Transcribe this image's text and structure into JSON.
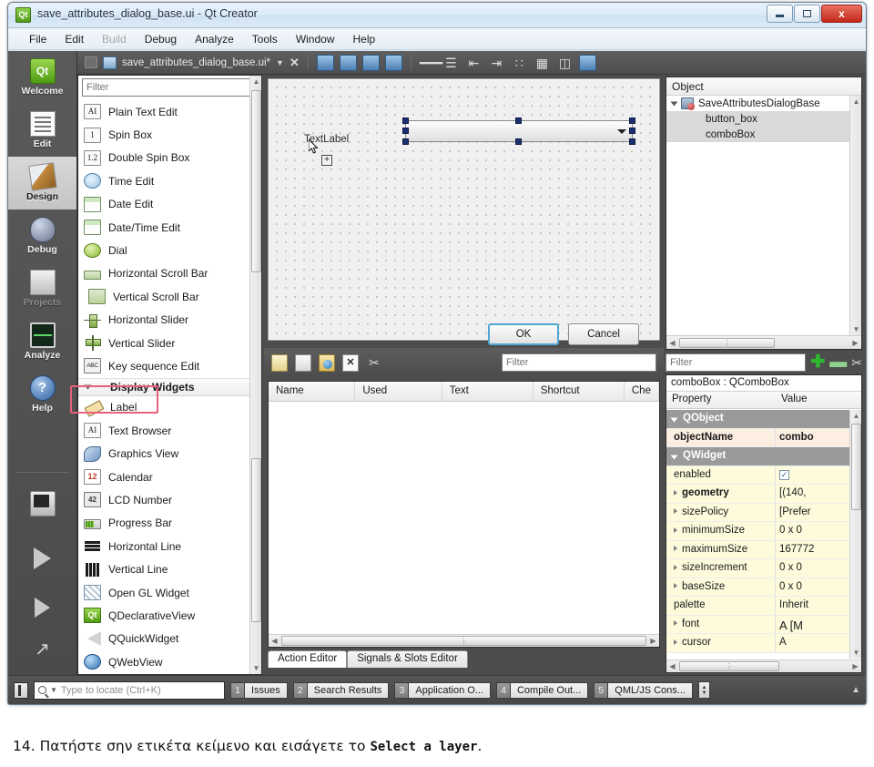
{
  "window": {
    "title": "save_attributes_dialog_base.ui - Qt Creator",
    "app_icon": "qt-logo-icon",
    "minimize_label": "",
    "maximize_label": "",
    "close_label": "x"
  },
  "menubar": {
    "items": [
      {
        "label": "File",
        "disabled": false
      },
      {
        "label": "Edit",
        "disabled": false
      },
      {
        "label": "Build",
        "disabled": true
      },
      {
        "label": "Debug",
        "disabled": false
      },
      {
        "label": "Analyze",
        "disabled": false
      },
      {
        "label": "Tools",
        "disabled": false
      },
      {
        "label": "Window",
        "disabled": false
      },
      {
        "label": "Help",
        "disabled": false
      }
    ]
  },
  "modebar": {
    "items": [
      {
        "label": "Welcome",
        "icon": "qt-logo-icon",
        "active": false,
        "dim": false
      },
      {
        "label": "Edit",
        "icon": "document-lines-icon",
        "active": false,
        "dim": false
      },
      {
        "label": "Design",
        "icon": "paintbrush-icon",
        "active": true,
        "dim": false
      },
      {
        "label": "Debug",
        "icon": "bug-icon",
        "active": false,
        "dim": false
      },
      {
        "label": "Projects",
        "icon": "folder-icon",
        "active": false,
        "dim": true
      },
      {
        "label": "Analyze",
        "icon": "oscilloscope-icon",
        "active": false,
        "dim": false
      },
      {
        "label": "Help",
        "icon": "question-mark-icon",
        "active": false,
        "dim": false
      }
    ]
  },
  "filebar": {
    "lock_icon": "unlocked-padlock-icon",
    "file_icon": "ui-file-icon",
    "filename": "save_attributes_dialog_base.ui*",
    "dropdown_icon": "chevron-down-icon",
    "close_icon": "close-x-icon",
    "designer_tools": [
      {
        "name": "edit-widgets-icon"
      },
      {
        "name": "edit-signals-slots-icon"
      },
      {
        "name": "edit-buddies-icon"
      },
      {
        "name": "edit-tab-order-icon"
      },
      {
        "name": "layout-horizontally-icon"
      },
      {
        "name": "layout-vertically-icon"
      },
      {
        "name": "layout-splitter-horizontal-icon"
      },
      {
        "name": "layout-splitter-vertical-icon"
      },
      {
        "name": "layout-form-icon"
      },
      {
        "name": "layout-grid-icon"
      },
      {
        "name": "break-layout-icon"
      },
      {
        "name": "adjust-size-icon"
      }
    ]
  },
  "widgetbox": {
    "filter_placeholder": "Filter",
    "filter_value": "",
    "items": [
      {
        "label": "Plain Text Edit",
        "icon": "plain-text-edit-icon",
        "kind": "item",
        "glyph": "AI"
      },
      {
        "label": "Spin Box",
        "icon": "spin-box-icon",
        "kind": "item",
        "glyph": "1"
      },
      {
        "label": "Double Spin Box",
        "icon": "double-spin-box-icon",
        "kind": "item",
        "glyph": "1.2"
      },
      {
        "label": "Time Edit",
        "icon": "time-edit-icon",
        "kind": "item",
        "glyph": ""
      },
      {
        "label": "Date Edit",
        "icon": "date-edit-icon",
        "kind": "item",
        "glyph": ""
      },
      {
        "label": "Date/Time Edit",
        "icon": "date-time-edit-icon",
        "kind": "item",
        "glyph": ""
      },
      {
        "label": "Dial",
        "icon": "dial-icon",
        "kind": "item",
        "glyph": ""
      },
      {
        "label": "Horizontal Scroll Bar",
        "icon": "horizontal-scroll-bar-icon",
        "kind": "item",
        "glyph": ""
      },
      {
        "label": "Vertical Scroll Bar",
        "icon": "vertical-scroll-bar-icon",
        "kind": "item",
        "glyph": ""
      },
      {
        "label": "Horizontal Slider",
        "icon": "horizontal-slider-icon",
        "kind": "item",
        "glyph": ""
      },
      {
        "label": "Vertical Slider",
        "icon": "vertical-slider-icon",
        "kind": "item",
        "glyph": ""
      },
      {
        "label": "Key sequence Edit",
        "icon": "key-sequence-edit-icon",
        "kind": "item",
        "glyph": "ABC"
      },
      {
        "label": "Display Widgets",
        "icon": "category-collapse-icon",
        "kind": "category",
        "glyph": ""
      },
      {
        "label": "Label",
        "icon": "label-icon",
        "kind": "item",
        "glyph": ""
      },
      {
        "label": "Text Browser",
        "icon": "text-browser-icon",
        "kind": "item",
        "glyph": "AI"
      },
      {
        "label": "Graphics View",
        "icon": "graphics-view-icon",
        "kind": "item",
        "glyph": ""
      },
      {
        "label": "Calendar",
        "icon": "calendar-icon",
        "kind": "item",
        "glyph": "12"
      },
      {
        "label": "LCD Number",
        "icon": "lcd-number-icon",
        "kind": "item",
        "glyph": "42"
      },
      {
        "label": "Progress Bar",
        "icon": "progress-bar-icon",
        "kind": "item",
        "glyph": ""
      },
      {
        "label": "Horizontal Line",
        "icon": "horizontal-line-icon",
        "kind": "item",
        "glyph": ""
      },
      {
        "label": "Vertical Line",
        "icon": "vertical-line-icon",
        "kind": "item",
        "glyph": ""
      },
      {
        "label": "Open GL Widget",
        "icon": "open-gl-widget-icon",
        "kind": "item",
        "glyph": ""
      },
      {
        "label": "QDeclarativeView",
        "icon": "qt-logo-icon",
        "kind": "item",
        "glyph": "Qt"
      },
      {
        "label": "QQuickWidget",
        "icon": "qquick-widget-icon",
        "kind": "item",
        "glyph": ""
      },
      {
        "label": "QWebView",
        "icon": "qweb-view-icon",
        "kind": "item",
        "glyph": ""
      }
    ],
    "highlighted_item": "Label"
  },
  "form": {
    "label_text": "TextLabel",
    "combobox_selected": true,
    "ok_button": "OK",
    "cancel_button": "Cancel",
    "cursor_icon": "mouse-pointer-icon",
    "drop-badge": "+"
  },
  "action_editor": {
    "toolbar": [
      {
        "name": "new-action-icon"
      },
      {
        "name": "open-folder-icon"
      },
      {
        "name": "copy-action-icon"
      },
      {
        "name": "delete-action-icon"
      },
      {
        "name": "configure-wrench-icon"
      }
    ],
    "filter_placeholder": "Filter",
    "filter_value": "",
    "columns": [
      "Name",
      "Used",
      "Text",
      "Shortcut",
      "Che"
    ],
    "rows": [],
    "tabs": [
      {
        "label": "Action Editor",
        "active": true
      },
      {
        "label": "Signals & Slots Editor",
        "active": false
      }
    ]
  },
  "object_inspector": {
    "header": "Object",
    "nodes": [
      {
        "label": "SaveAttributesDialogBase",
        "depth": 0,
        "selected": false,
        "has_icon": true,
        "expanded": true
      },
      {
        "label": "button_box",
        "depth": 1,
        "selected": true,
        "has_icon": false,
        "expanded": false
      },
      {
        "label": "comboBox",
        "depth": 1,
        "selected": true,
        "has_icon": false,
        "expanded": false
      }
    ]
  },
  "property_editor": {
    "filter_placeholder": "Filter",
    "filter_value": "",
    "add_icon": "plus-icon",
    "remove_icon": "minus-icon",
    "configure_icon": "wrench-icon",
    "subject": "comboBox : QComboBox",
    "columns": [
      "Property",
      "Value"
    ],
    "rows": [
      {
        "name": "QObject",
        "value": "",
        "type": "group"
      },
      {
        "name": "objectName",
        "value": "combo",
        "type": "peach",
        "expandable": false,
        "bold": true
      },
      {
        "name": "QWidget",
        "value": "",
        "type": "group"
      },
      {
        "name": "enabled",
        "value": "",
        "type": "yellow",
        "expandable": false,
        "checkbox": true
      },
      {
        "name": "geometry",
        "value": "[(140, ",
        "type": "yellow",
        "expandable": true,
        "bold": true
      },
      {
        "name": "sizePolicy",
        "value": "[Prefer",
        "type": "yellow",
        "expandable": true
      },
      {
        "name": "minimumSize",
        "value": "0 x 0",
        "type": "yellow",
        "expandable": true
      },
      {
        "name": "maximumSize",
        "value": "167772",
        "type": "yellow",
        "expandable": true
      },
      {
        "name": "sizeIncrement",
        "value": "0 x 0",
        "type": "yellow",
        "expandable": true
      },
      {
        "name": "baseSize",
        "value": "0 x 0",
        "type": "yellow",
        "expandable": true
      },
      {
        "name": "palette",
        "value": "Inherit",
        "type": "yellow",
        "expandable": false
      },
      {
        "name": "font",
        "value": "A  [M",
        "type": "yellow",
        "expandable": true
      },
      {
        "name": "cursor",
        "value": "A",
        "type": "yellow",
        "expandable": false
      }
    ]
  },
  "statusbar": {
    "toggle_sidebar_icon": "toggle-sidebar-icon",
    "locate_placeholder": "Type to locate (Ctrl+K)",
    "locate_value": "",
    "search_icon": "magnifier-icon",
    "outputs": [
      {
        "num": "1",
        "label": "Issues"
      },
      {
        "num": "2",
        "label": "Search Results"
      },
      {
        "num": "3",
        "label": "Application O..."
      },
      {
        "num": "4",
        "label": "Compile Out..."
      },
      {
        "num": "5",
        "label": "QML/JS Cons..."
      }
    ]
  },
  "caption": {
    "prefix": "14. Πατήστε σην ετικέτα κείμενο και εισάγετε το ",
    "code": "Select a layer",
    "suffix": "."
  }
}
